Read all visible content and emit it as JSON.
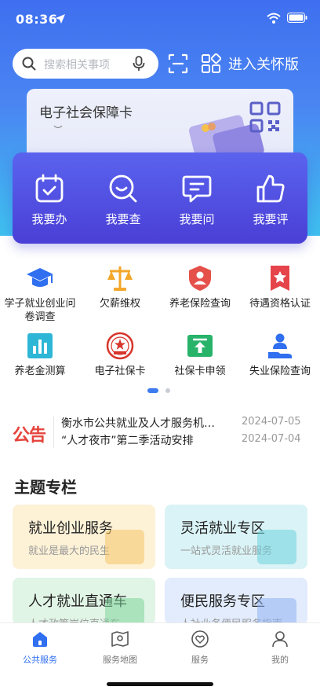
{
  "status": {
    "time": "08:36"
  },
  "header": {
    "search_placeholder": "搜索相关事项",
    "care_mode_label": "进入关怀版"
  },
  "card": {
    "title": "电子社会保障卡"
  },
  "actions": [
    {
      "label": "我要办",
      "icon": "calendar-check-icon"
    },
    {
      "label": "我要查",
      "icon": "search-smile-icon"
    },
    {
      "label": "我要问",
      "icon": "chat-bubble-icon"
    },
    {
      "label": "我要评",
      "icon": "thumbs-up-icon"
    }
  ],
  "services": [
    {
      "label": "学子就业创业问卷调查",
      "icon": "graduation-cap-icon",
      "color": "#2f6ff0"
    },
    {
      "label": "欠薪维权",
      "icon": "scales-icon",
      "color": "#f3a72a"
    },
    {
      "label": "养老保险查询",
      "icon": "elder-shield-icon",
      "color": "#e5504a"
    },
    {
      "label": "待遇资格认证",
      "icon": "star-badge-icon",
      "color": "#e5444a"
    },
    {
      "label": "养老金测算",
      "icon": "bar-chart-icon",
      "color": "#2db6d6"
    },
    {
      "label": "电子社保卡",
      "icon": "emblem-icon",
      "color": "#d8352c"
    },
    {
      "label": "社保卡申领",
      "icon": "upload-card-icon",
      "color": "#27b36a"
    },
    {
      "label": "失业保险查询",
      "icon": "person-hand-icon",
      "color": "#2f6ff0"
    }
  ],
  "notice": {
    "badge": "公告",
    "items": [
      {
        "title": "衡水市公共就业及人才服务机…",
        "date": "2024-07-05"
      },
      {
        "title": "“人才夜市”第二季活动安排",
        "date": "2024-07-04"
      }
    ]
  },
  "topics": {
    "heading": "主题专栏",
    "items": [
      {
        "title": "就业创业服务",
        "subtitle": "就业是最大的民生",
        "bg": "#fdf1d6",
        "accent": "#f4c46a"
      },
      {
        "title": "灵活就业专区",
        "subtitle": "一站式灵活就业服务",
        "bg": "#daf3f6",
        "accent": "#6ed2df"
      },
      {
        "title": "人才就业直通车",
        "subtitle": "人才政策岗位直通车",
        "bg": "#e1f5e6",
        "accent": "#7fd49a"
      },
      {
        "title": "便民服务专区",
        "subtitle": "人社业务便民服务指南",
        "bg": "#e2ecfd",
        "accent": "#8fb2f2"
      }
    ]
  },
  "tabbar": [
    {
      "label": "公共服务",
      "icon": "home-icon",
      "active": true
    },
    {
      "label": "服务地图",
      "icon": "map-icon",
      "active": false
    },
    {
      "label": "服务",
      "icon": "heart-icon",
      "active": false
    },
    {
      "label": "我的",
      "icon": "user-icon",
      "active": false
    }
  ]
}
